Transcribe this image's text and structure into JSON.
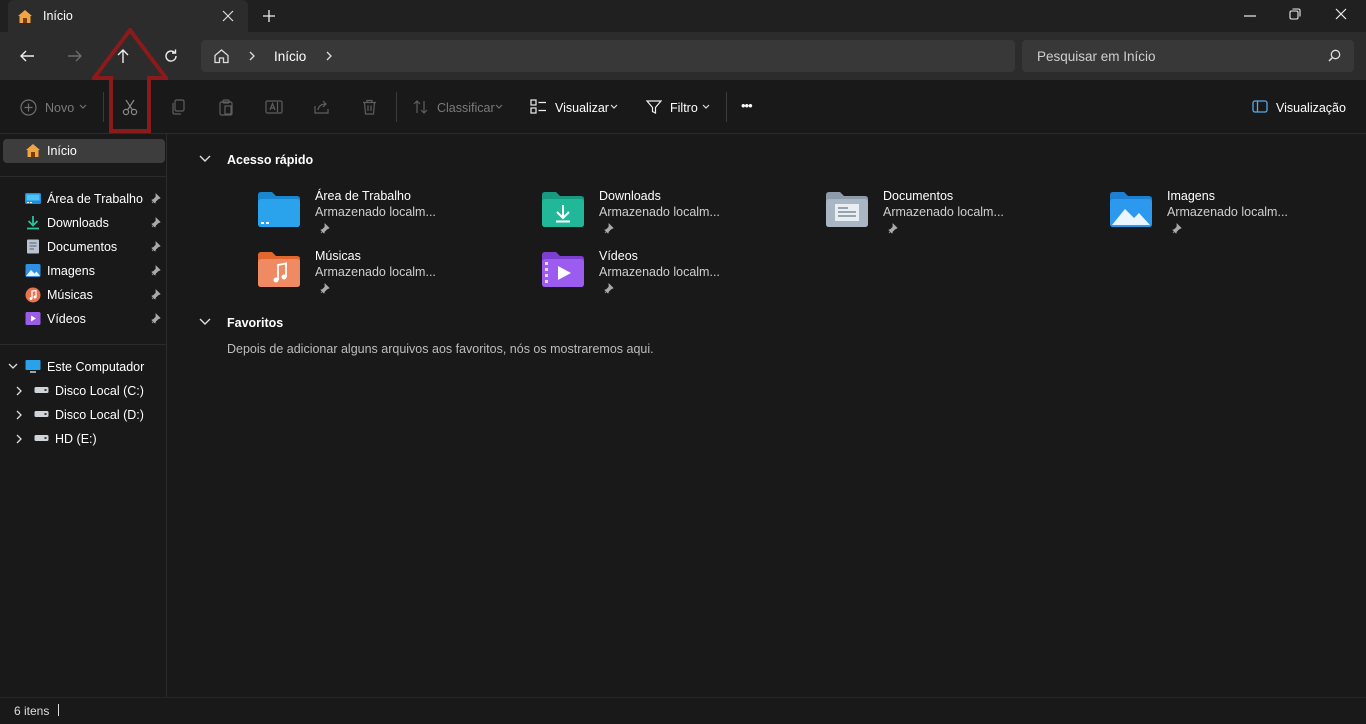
{
  "window": {
    "tab_title": "Início",
    "new_tab_symbol": "+"
  },
  "nav": {
    "breadcrumb": "Início",
    "search_placeholder": "Pesquisar em Início"
  },
  "commands": {
    "new": "Novo",
    "sort": "Classificar",
    "view": "Visualizar",
    "filter": "Filtro",
    "more": "•••",
    "preview": "Visualização"
  },
  "sidebar": {
    "home": "Início",
    "pinned": [
      {
        "label": "Área de Trabalho",
        "icon": "desktop-icon"
      },
      {
        "label": "Downloads",
        "icon": "downloads-icon"
      },
      {
        "label": "Documentos",
        "icon": "documents-icon"
      },
      {
        "label": "Imagens",
        "icon": "pictures-icon"
      },
      {
        "label": "Músicas",
        "icon": "music-icon"
      },
      {
        "label": "Vídeos",
        "icon": "videos-icon"
      }
    ],
    "this_pc": "Este Computador",
    "drives": [
      {
        "label": "Disco Local (C:)"
      },
      {
        "label": "Disco Local (D:)"
      },
      {
        "label": "HD (E:)"
      }
    ]
  },
  "main": {
    "quick_access_title": "Acesso rápido",
    "quick_access": [
      {
        "name": "Área de Trabalho",
        "sub": "Armazenado localm...",
        "icon": "desktop-folder-icon"
      },
      {
        "name": "Downloads",
        "sub": "Armazenado localm...",
        "icon": "downloads-folder-icon"
      },
      {
        "name": "Documentos",
        "sub": "Armazenado localm...",
        "icon": "documents-folder-icon"
      },
      {
        "name": "Imagens",
        "sub": "Armazenado localm...",
        "icon": "pictures-folder-icon"
      },
      {
        "name": "Músicas",
        "sub": "Armazenado localm...",
        "icon": "music-folder-icon"
      },
      {
        "name": "Vídeos",
        "sub": "Armazenado localm...",
        "icon": "videos-folder-icon"
      }
    ],
    "favorites_title": "Favoritos",
    "favorites_empty": "Depois de adicionar alguns arquivos aos favoritos, nós os mostraremos aqui."
  },
  "status": {
    "item_count": "6 itens"
  },
  "colors": {
    "background": "#191919",
    "titlebar": "#202020",
    "navbar": "#2c2c2c",
    "annotation": "#8b1a1a"
  }
}
